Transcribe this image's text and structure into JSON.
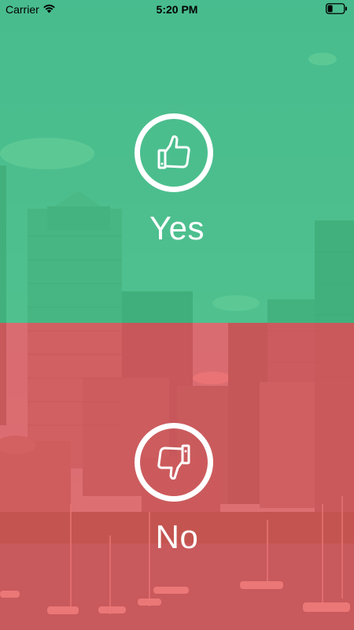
{
  "status_bar": {
    "carrier": "Carrier",
    "time": "5:20 PM",
    "wifi_icon": "wifi-icon",
    "battery_icon": "battery-icon"
  },
  "choices": {
    "yes": {
      "label": "Yes",
      "icon": "thumbs-up-icon",
      "color": "#34be78"
    },
    "no": {
      "label": "No",
      "icon": "thumbs-down-icon",
      "color": "#e84c4c"
    }
  },
  "background": {
    "icon": "city-skyline-photo"
  }
}
